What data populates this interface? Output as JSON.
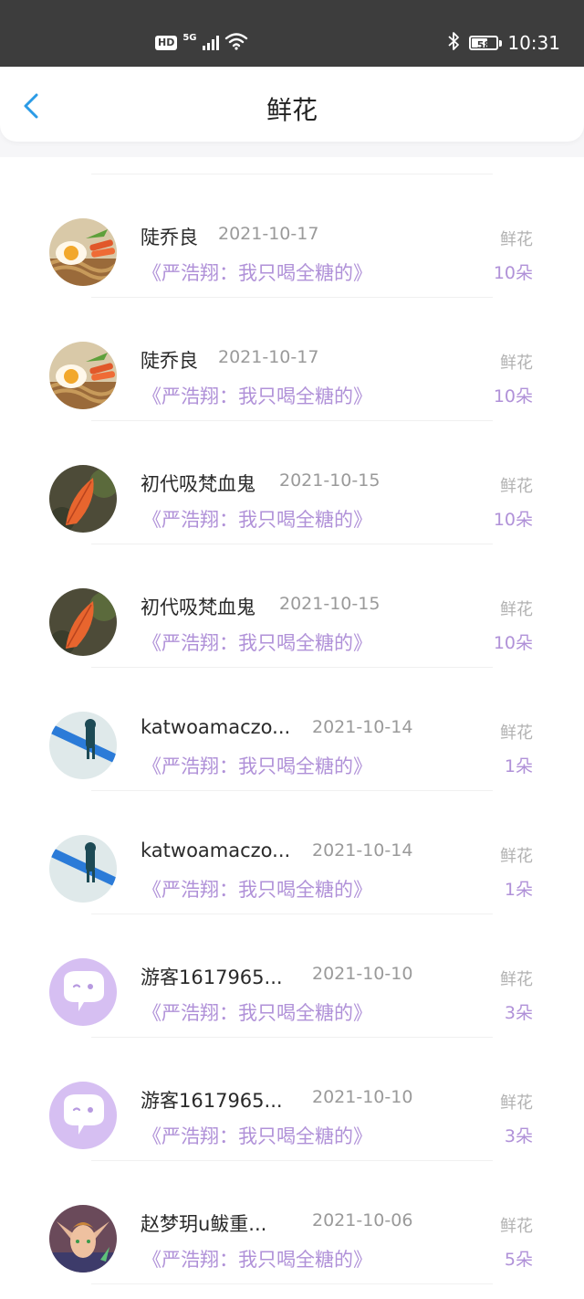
{
  "status_bar": {
    "hd": "HD",
    "network": "5G",
    "battery": "58",
    "time": "10:31"
  },
  "header": {
    "title": "鲜花",
    "back_icon": "chevron-left-icon"
  },
  "colors": {
    "accent_purple": "#b091d8",
    "back_blue": "#2b9be6",
    "status_bar_bg": "#3d3d3d"
  },
  "records": [
    {
      "avatar": "egg-noodle-photo",
      "name": "陡乔良",
      "date": "2021-10-17",
      "title": "《严浩翔：我只喝全糖的》",
      "gift": "鲜花",
      "count": "10朵"
    },
    {
      "avatar": "egg-noodle-photo",
      "name": "陡乔良",
      "date": "2021-10-17",
      "title": "《严浩翔：我只喝全糖的》",
      "gift": "鲜花",
      "count": "10朵"
    },
    {
      "avatar": "red-leaf-photo",
      "name": "初代吸梵血鬼",
      "date": "2021-10-15",
      "title": "《严浩翔：我只喝全糖的》",
      "gift": "鲜花",
      "count": "10朵"
    },
    {
      "avatar": "red-leaf-photo",
      "name": "初代吸梵血鬼",
      "date": "2021-10-15",
      "title": "《严浩翔：我只喝全糖的》",
      "gift": "鲜花",
      "count": "10朵"
    },
    {
      "avatar": "figure-banner-photo",
      "name": "katwoamaczo...",
      "date": "2021-10-14",
      "title": "《严浩翔：我只喝全糖的》",
      "gift": "鲜花",
      "count": "1朵"
    },
    {
      "avatar": "figure-banner-photo",
      "name": "katwoamaczo...",
      "date": "2021-10-14",
      "title": "《严浩翔：我只喝全糖的》",
      "gift": "鲜花",
      "count": "1朵"
    },
    {
      "avatar": "default-chat-avatar",
      "name": "游客1617965...",
      "date": "2021-10-10",
      "title": "《严浩翔：我只喝全糖的》",
      "gift": "鲜花",
      "count": "3朵"
    },
    {
      "avatar": "default-chat-avatar",
      "name": "游客1617965...",
      "date": "2021-10-10",
      "title": "《严浩翔：我只喝全糖的》",
      "gift": "鲜花",
      "count": "3朵"
    },
    {
      "avatar": "elf-character-photo",
      "name": "赵梦玥u鲅重...",
      "date": "2021-10-06",
      "title": "《严浩翔：我只喝全糖的》",
      "gift": "鲜花",
      "count": "5朵"
    }
  ]
}
